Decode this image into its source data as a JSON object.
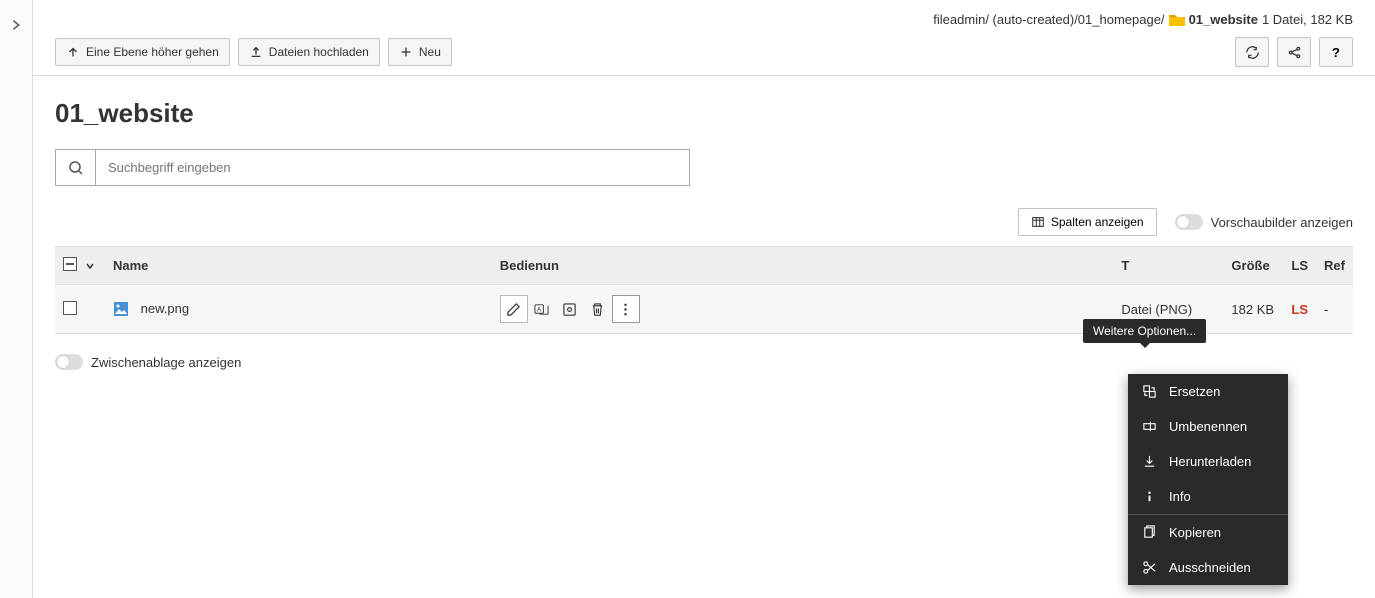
{
  "breadcrumb": {
    "path1": "fileadmin/ (auto-created)/01_homepage/",
    "current": "01_website",
    "stats": "1 Datei, 182 KB"
  },
  "toolbar": {
    "up_label": "Eine Ebene höher gehen",
    "upload_label": "Dateien hochladen",
    "new_label": "Neu"
  },
  "page": {
    "title": "01_website"
  },
  "search": {
    "placeholder": "Suchbegriff eingeben"
  },
  "view": {
    "columns_button": "Spalten anzeigen",
    "thumbnails_label": "Vorschaubilder anzeigen"
  },
  "table": {
    "headers": {
      "name": "Name",
      "control": "Bedienun",
      "type": "T",
      "size": "Größe",
      "ls": "LS",
      "ref": "Ref"
    },
    "rows": [
      {
        "name": "new.png",
        "type": "Datei (PNG)",
        "size": "182 KB",
        "ls": "LS",
        "ref": "-"
      }
    ]
  },
  "tooltip": {
    "text": "Weitere Optionen..."
  },
  "dropdown": {
    "replace": "Ersetzen",
    "rename": "Umbenennen",
    "download": "Herunterladen",
    "info": "Info",
    "copy": "Kopieren",
    "cut": "Ausschneiden"
  },
  "clipboard": {
    "label": "Zwischenablage anzeigen"
  },
  "help": {
    "label": "?"
  }
}
